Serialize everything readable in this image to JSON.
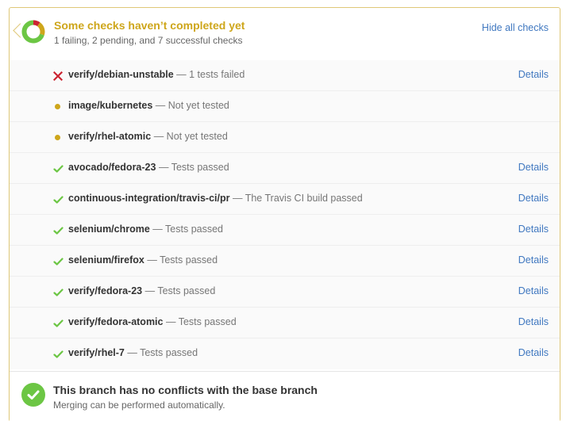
{
  "header": {
    "title": "Some checks haven’t completed yet",
    "summary": "1 failing, 2 pending, and 7 successful checks",
    "hide_label": "Hide all checks"
  },
  "checks": [
    {
      "status": "failure",
      "icon": "x-icon",
      "name": "verify/debian-unstable",
      "description": " — 1 tests failed",
      "details": "Details"
    },
    {
      "status": "pending",
      "icon": "pending-dot-icon",
      "name": "image/kubernetes",
      "description": " — Not yet tested",
      "details": ""
    },
    {
      "status": "pending",
      "icon": "pending-dot-icon",
      "name": "verify/rhel-atomic",
      "description": " — Not yet tested",
      "details": ""
    },
    {
      "status": "success",
      "icon": "check-icon",
      "name": "avocado/fedora-23",
      "description": " — Tests passed",
      "details": "Details"
    },
    {
      "status": "success",
      "icon": "check-icon",
      "name": "continuous-integration/travis-ci/pr",
      "description": " — The Travis CI build passed",
      "details": "Details"
    },
    {
      "status": "success",
      "icon": "check-icon",
      "name": "selenium/chrome",
      "description": " — Tests passed",
      "details": "Details"
    },
    {
      "status": "success",
      "icon": "check-icon",
      "name": "selenium/firefox",
      "description": " — Tests passed",
      "details": "Details"
    },
    {
      "status": "success",
      "icon": "check-icon",
      "name": "verify/fedora-23",
      "description": " — Tests passed",
      "details": "Details"
    },
    {
      "status": "success",
      "icon": "check-icon",
      "name": "verify/fedora-atomic",
      "description": " — Tests passed",
      "details": "Details"
    },
    {
      "status": "success",
      "icon": "check-icon",
      "name": "verify/rhel-7",
      "description": " — Tests passed",
      "details": "Details"
    }
  ],
  "merge": {
    "icon": "check-circle-icon",
    "title": "This branch has no conflicts with the base branch",
    "subtitle": "Merging can be performed automatically."
  },
  "colors": {
    "failure": "#cb2431",
    "pending": "#cea61b",
    "success": "#6cc644",
    "link": "#4078c0"
  },
  "summary_counts": {
    "failing": 1,
    "pending": 2,
    "successful": 7
  }
}
